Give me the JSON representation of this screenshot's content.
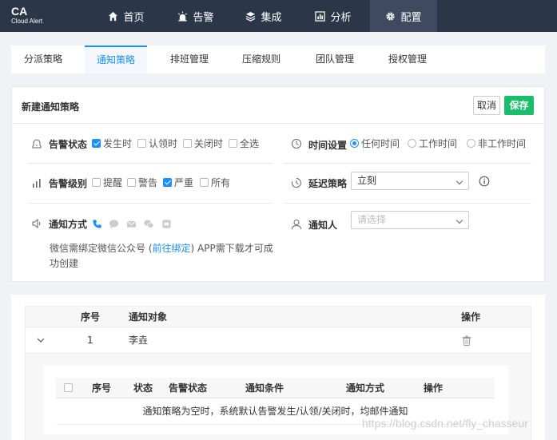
{
  "app": {
    "logo": "CA",
    "subtitle": "Cloud Alert"
  },
  "nav": [
    {
      "label": "首页",
      "icon": "home-icon"
    },
    {
      "label": "告警",
      "icon": "siren-icon"
    },
    {
      "label": "集成",
      "icon": "layers-icon"
    },
    {
      "label": "分析",
      "icon": "chart-icon"
    },
    {
      "label": "配置",
      "icon": "gear-icon",
      "active": true
    }
  ],
  "tabs": [
    "分派策略",
    "通知策略",
    "排班管理",
    "压缩规则",
    "团队管理",
    "授权管理"
  ],
  "form": {
    "title": "新建通知策略",
    "cancel": "取消",
    "save": "保存",
    "alert_status": {
      "label": "告警状态",
      "options": [
        {
          "label": "发生时",
          "checked": true
        },
        {
          "label": "认领时",
          "checked": false
        },
        {
          "label": "关闭时",
          "checked": false
        },
        {
          "label": "全选",
          "checked": false
        }
      ]
    },
    "time_setting": {
      "label": "时间设置",
      "options": [
        {
          "label": "任何时间",
          "selected": true
        },
        {
          "label": "工作时间",
          "selected": false
        },
        {
          "label": "非工作时间",
          "selected": false
        }
      ]
    },
    "alert_level": {
      "label": "告警级别",
      "options": [
        {
          "label": "提醒",
          "checked": false
        },
        {
          "label": "警告",
          "checked": false
        },
        {
          "label": "严重",
          "checked": true
        },
        {
          "label": "所有",
          "checked": false
        }
      ]
    },
    "delay": {
      "label": "延迟策略",
      "value": "立刻"
    },
    "notify_method": {
      "label": "通知方式",
      "note_before": "微信需绑定微信公众号 (",
      "note_link": "前往绑定",
      "note_after": ") APP需下载才可成功创建"
    },
    "notifier": {
      "label": "通知人",
      "placeholder": "请选择"
    }
  },
  "table": {
    "headers": [
      "序号",
      "通知对象",
      "操作"
    ],
    "rows": [
      {
        "index": "1",
        "target": "李垚"
      }
    ],
    "inner_headers": [
      "序号",
      "状态",
      "告警状态",
      "通知条件",
      "通知方式",
      "操作"
    ],
    "inner_empty": "通知策略为空时，系统默认告警发生/认领/关闭时，均邮件通知"
  },
  "watermark": "https://blog.csdn.net/fly_chasseur",
  "colors": {
    "nav_bg": "#2b3648",
    "accent": "#1890ff",
    "save": "#19be6b"
  }
}
